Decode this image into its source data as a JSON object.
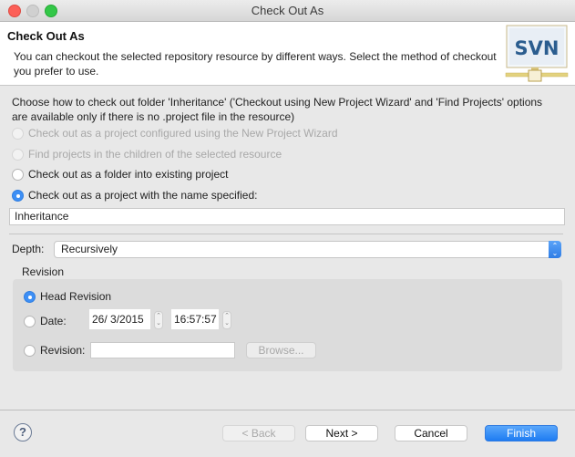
{
  "window": {
    "title": "Check Out As",
    "controls": [
      "close",
      "minimize",
      "maximize"
    ]
  },
  "header": {
    "title": "Check Out As",
    "description": "You can checkout the selected repository resource by different ways. Select the method of checkout you prefer to use.",
    "logo_text": "SVN"
  },
  "main": {
    "instructions": "Choose how to check out folder 'Inheritance' ('Checkout using New Project Wizard' and 'Find Projects' options are available only if there is no .project file in the resource)",
    "options": [
      {
        "label": "Check out as a project configured using the New Project Wizard",
        "checked": false,
        "enabled": false
      },
      {
        "label": "Find projects in the children of the selected resource",
        "checked": false,
        "enabled": false
      },
      {
        "label": "Check out as a folder into existing project",
        "checked": false,
        "enabled": true
      },
      {
        "label": "Check out as a project with the name specified:",
        "checked": true,
        "enabled": true
      }
    ],
    "project_name": "Inheritance",
    "depth": {
      "label": "Depth:",
      "selected": "Recursively"
    },
    "revision": {
      "group_label": "Revision",
      "head_label": "Head Revision",
      "date_label": "Date:",
      "date_value": "26/  3/2015",
      "time_value": "16:57:57",
      "revision_label": "Revision:",
      "revision_value": "",
      "browse_label": "Browse...",
      "selected": "head"
    }
  },
  "footer": {
    "help_icon": "?",
    "back_label": "< Back",
    "next_label": "Next >",
    "cancel_label": "Cancel",
    "finish_label": "Finish"
  },
  "colors": {
    "accent": "#3d8ff5",
    "primary_button": "#1e7cf2"
  }
}
